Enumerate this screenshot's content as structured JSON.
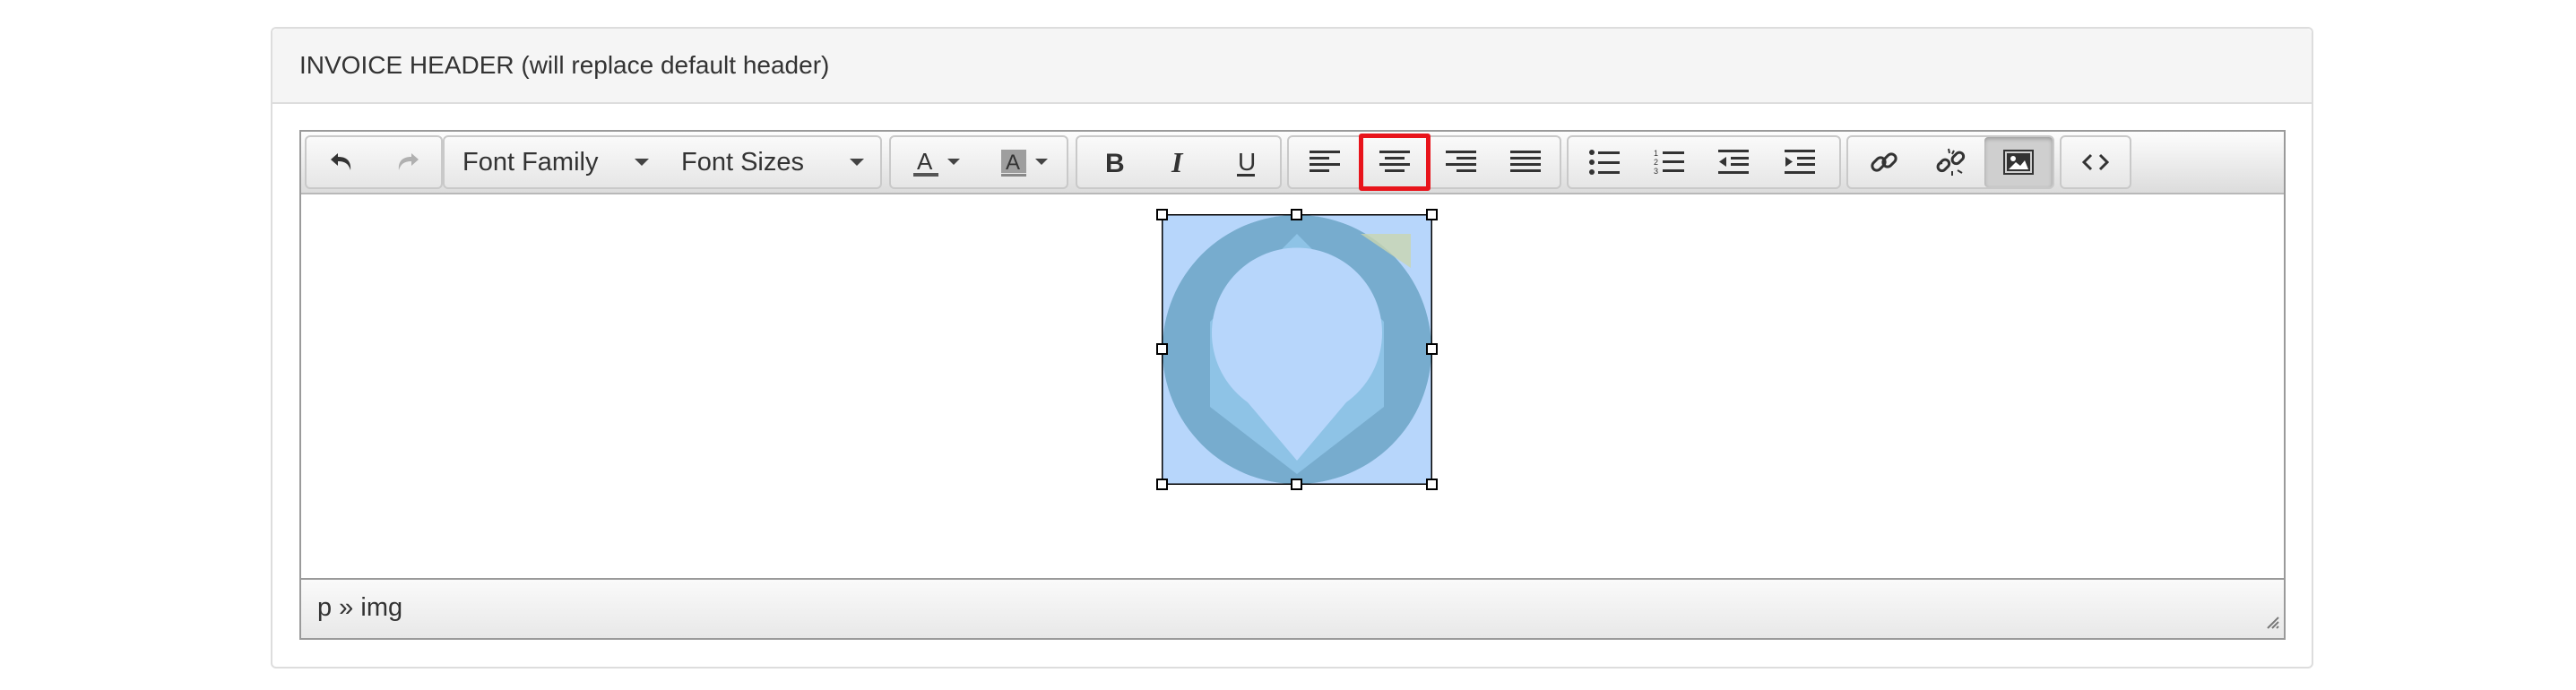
{
  "panel": {
    "title": "INVOICE HEADER (will replace default header)"
  },
  "toolbar": {
    "undo_icon": "undo-icon",
    "redo_icon": "redo-icon",
    "font_family": {
      "selected": "Font Family"
    },
    "font_size": {
      "selected": "Font Sizes"
    },
    "text_color_icon": "text-color-icon",
    "background_color_icon": "background-color-icon",
    "bold_icon": "bold-icon",
    "italic_icon": "italic-icon",
    "underline_icon": "underline-icon",
    "align_left_icon": "align-left-icon",
    "align_center_icon": "align-center-icon",
    "align_right_icon": "align-right-icon",
    "align_justify_icon": "align-justify-icon",
    "bullet_list_icon": "bullet-list-icon",
    "numbered_list_icon": "numbered-list-icon",
    "outdent_icon": "outdent-icon",
    "indent_icon": "indent-icon",
    "link_icon": "link-icon",
    "unlink_icon": "unlink-icon",
    "image_icon": "image-icon",
    "source_code_icon": "source-code-icon",
    "image_button_state": "active",
    "align_center_state": "highlighted"
  },
  "content": {
    "image_icon": "logo-image",
    "image_state": "selected"
  },
  "statusbar": {
    "path": "p » img",
    "resize_icon": "resize-grip-icon"
  },
  "colors": {
    "highlight": "#e8141b",
    "image_selection": "#b7d6fb"
  }
}
